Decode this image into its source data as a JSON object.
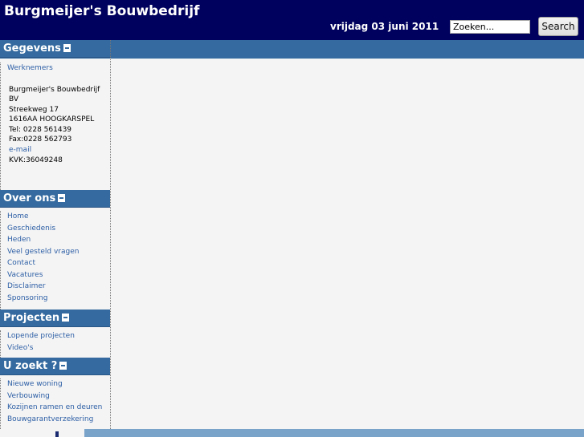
{
  "header": {
    "title": "Burgmeijer's Bouwbedrijf",
    "date": "vrijdag 03 juni 2011",
    "search_placeholder": "Zoeken...",
    "search_value": "Zoeken...",
    "search_button": "Search"
  },
  "sidebar": {
    "gegevens": {
      "title": "Gegevens",
      "link": "Werknemers",
      "address": [
        "Burgmeijer's Bouwbedrijf",
        "BV",
        "Streekweg 17",
        "1616AA HOOGKARSPEL",
        "Tel: 0228 561439",
        "Fax:0228 562793"
      ],
      "email": "e-mail",
      "kvk": "KVK:36049248"
    },
    "over_ons": {
      "title": "Over ons",
      "items": [
        "Home",
        "Geschiedenis",
        "Heden",
        "Veel gesteld vragen",
        "Contact",
        "Vacatures",
        "Disclaimer",
        "Sponsoring"
      ]
    },
    "projecten": {
      "title": "Projecten",
      "items": [
        "Lopende projecten",
        "Video's"
      ]
    },
    "u_zoekt": {
      "title": "U zoekt ?",
      "items": [
        "Nieuwe woning",
        "Verbouwing",
        "Kozijnen ramen en deuren",
        "Bouwgarantverzekering"
      ]
    }
  },
  "colors": {
    "header_bg": "#00005e",
    "section_bg": "#346a9f",
    "link": "#2c5ea5"
  }
}
